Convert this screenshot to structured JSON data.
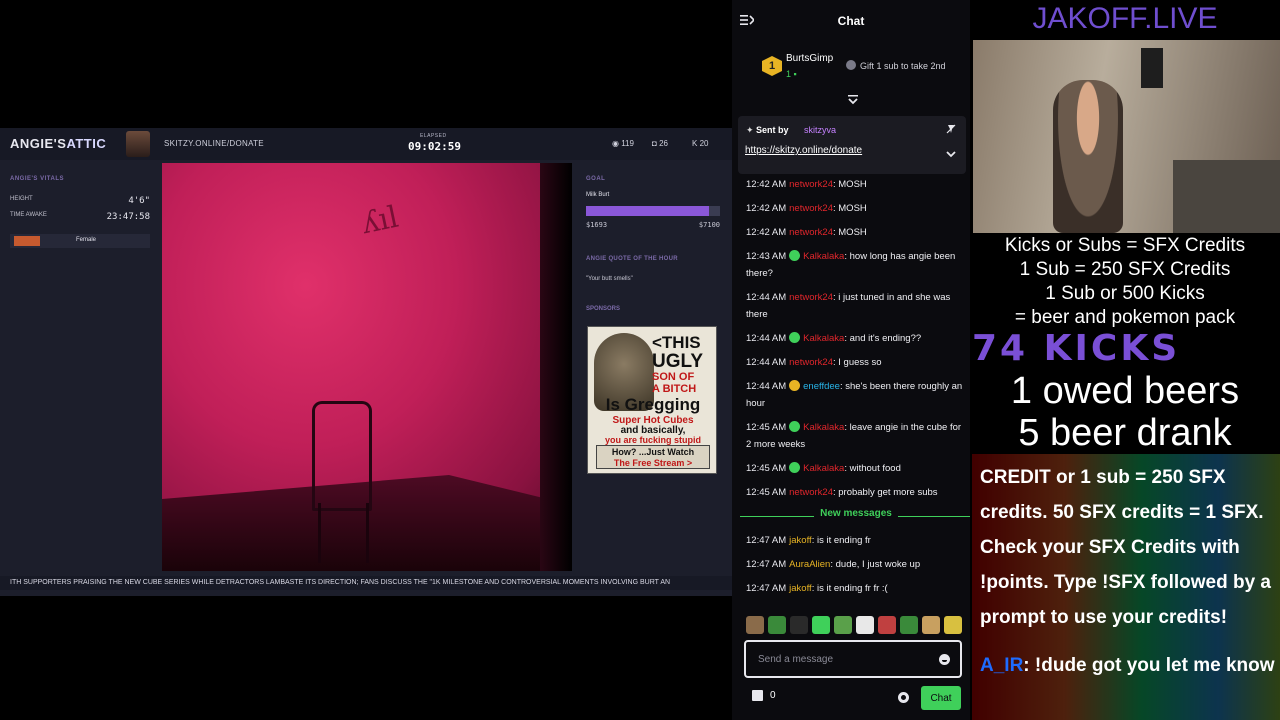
{
  "overlay": {
    "brand_main": "ANGIE'S",
    "brand_accent": "ATTIC",
    "donate_url": "SKITZY.ONLINE/DONATE",
    "elapsed_label": "ELAPSED",
    "elapsed": "09:02:59",
    "stats": [
      {
        "icon": "viewer-icon",
        "value": "119"
      },
      {
        "icon": "subs-icon",
        "value": "26"
      },
      {
        "icon": "kicks-icon",
        "value": "20"
      }
    ],
    "vitals": {
      "title": "ANGIE'S VITALS",
      "height_label": "HEIGHT",
      "height_value": "4'6\"",
      "awake_label": "TIME AWAKE",
      "awake_value": "23:47:58",
      "gender": "Female",
      "gender_color": "#c65a2f"
    },
    "goal": {
      "title": "GOAL",
      "name": "Milk Burt",
      "current": "$1693",
      "target": "$7100",
      "progress": 0.92,
      "bar_color": "#8a57d8"
    },
    "quote": {
      "title": "ANGIE QUOTE OF THE HOUR",
      "text": "\"Your butt smells\""
    },
    "sponsors_title": "SPONSORS",
    "ad": {
      "line1": "<THIS",
      "line2": "UGLY",
      "line3": "SON OF",
      "line4": "A BITCH",
      "big": "Is Gregging",
      "small1": "Super Hot Cubes",
      "small2": "and basically,",
      "small3": "you are fucking stupid",
      "btn1": "How? ...Just Watch",
      "btn2": "The Free Stream >"
    },
    "ticker": "ITH SUPPORTERS PRAISING THE NEW CUBE SERIES WHILE DETRACTORS LAMBASTE ITS DIRECTION; FANS DISCUSS THE \"1K MILESTONE AND CONTROVERSIAL MOMENTS INVOLVING BURT AN"
  },
  "chat": {
    "title": "Chat",
    "gift": {
      "rank": "1",
      "user": "BurtsGimp",
      "count": "1",
      "cta": "Gift 1 sub to take 2nd"
    },
    "pinned": {
      "label": "Sent by",
      "user": "skitzyva",
      "link": "https://skitzy.online/donate"
    },
    "messages": [
      {
        "time": "12:42 AM",
        "user": "network24",
        "color": "#e0262c",
        "badge": "",
        "text": ": MOSH"
      },
      {
        "time": "12:42 AM",
        "user": "network24",
        "color": "#e0262c",
        "badge": "",
        "text": ": MOSH"
      },
      {
        "time": "12:42 AM",
        "user": "network24",
        "color": "#e0262c",
        "badge": "",
        "text": ": MOSH"
      },
      {
        "time": "12:43 AM",
        "user": "Kalkalaka",
        "color": "#e0262c",
        "badge": "verified",
        "text": ": how long has angie been there?"
      },
      {
        "time": "12:44 AM",
        "user": "network24",
        "color": "#e0262c",
        "badge": "",
        "text": ": i just tuned in and she was there"
      },
      {
        "time": "12:44 AM",
        "user": "Kalkalaka",
        "color": "#e0262c",
        "badge": "verified",
        "text": ": and it's ending??"
      },
      {
        "time": "12:44 AM",
        "user": "network24",
        "color": "#e0262c",
        "badge": "",
        "text": ": I guess so"
      },
      {
        "time": "12:44 AM",
        "user": "eneffdee",
        "color": "#28b4e8",
        "badge": "sub",
        "text": ": she's been there roughly an hour"
      },
      {
        "time": "12:45 AM",
        "user": "Kalkalaka",
        "color": "#e0262c",
        "badge": "verified",
        "text": ": leave angie in the cube for 2 more weeks"
      },
      {
        "time": "12:45 AM",
        "user": "Kalkalaka",
        "color": "#e0262c",
        "badge": "verified",
        "text": ": without food"
      },
      {
        "time": "12:45 AM",
        "user": "network24",
        "color": "#e0262c",
        "badge": "",
        "text": ": probably get more subs"
      }
    ],
    "new_messages_label": "New messages",
    "new_messages": [
      {
        "time": "12:47 AM",
        "user": "jakoff",
        "color": "#e8b424",
        "badge": "",
        "text": ": is it ending fr"
      },
      {
        "time": "12:47 AM",
        "user": "AuraAlien",
        "color": "#e8b424",
        "badge": "",
        "text": ": dude, I just woke up"
      },
      {
        "time": "12:47 AM",
        "user": "jakoff",
        "color": "#e8b424",
        "badge": "",
        "text": ": is it ending fr fr :("
      }
    ],
    "emotes": [
      "#8a6b4a",
      "#3a8a3a",
      "#2a2a2a",
      "#3fd05a",
      "#5aa04a",
      "#e8e8e8",
      "#c04040",
      "#3a8a3a",
      "#c8a060",
      "#d8c040"
    ],
    "input_placeholder": "Send a message",
    "points": "0",
    "send_label": "Chat"
  },
  "right": {
    "site_title": "JAKOFF.LIVE",
    "info_lines": [
      "Kicks or Subs = SFX Credits",
      "1 Sub = 250 SFX Credits",
      "1 Sub or 500 Kicks",
      "= beer and pokemon pack"
    ],
    "kicks": "74 KICKS",
    "owed": "1 owed beers",
    "drank": "5 beer drank",
    "credits_text": "CREDIT or 1 sub = 250 SFX credits. 50 SFX credits = 1 SFX. Check your SFX Credits with !points. Type !SFX followed by a prompt to use your credits!",
    "credits_user": "A_IR",
    "credits_msg": ": !dude got you let me know"
  }
}
